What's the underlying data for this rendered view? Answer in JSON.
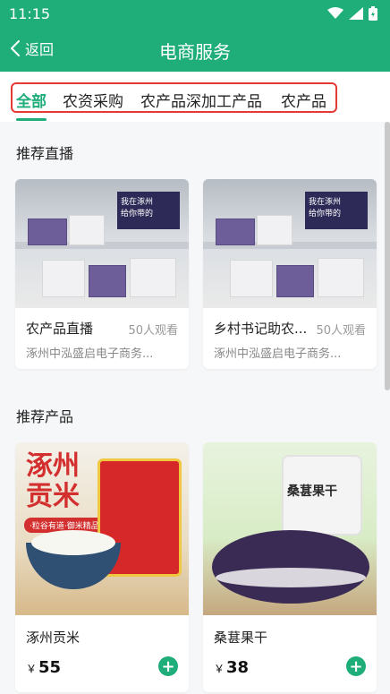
{
  "status_bar": {
    "time": "11:15"
  },
  "header": {
    "back_label": "返回",
    "title": "电商服务"
  },
  "tabs": [
    {
      "label": "全部",
      "active": true
    },
    {
      "label": "农资采购",
      "active": false
    },
    {
      "label": "农产品深加工产品",
      "active": false
    },
    {
      "label": "农产品",
      "active": false
    }
  ],
  "sections": {
    "live_title": "推荐直播",
    "products_title": "推荐产品"
  },
  "live_streams": [
    {
      "name": "农产品直播",
      "viewers": "50人观看",
      "company": "涿州中泓盛启电子商务..."
    },
    {
      "name": "乡村书记助农...",
      "viewers": "50人观看",
      "company": "涿州中泓盛启电子商务..."
    }
  ],
  "live_thumb": {
    "poster_line1": "我在涿州",
    "poster_line2": "给你带的"
  },
  "products": [
    {
      "name": "涿州贡米",
      "currency": "￥",
      "price": "55",
      "image_title": "涿州\n贡米",
      "image_tag": "·粒谷有道·御米精品"
    },
    {
      "name": "桑葚果干",
      "currency": "￥",
      "price": "38",
      "image_title": "桑葚果干"
    }
  ],
  "colors": {
    "brand": "#1fae7a",
    "highlight": "#e53935"
  }
}
